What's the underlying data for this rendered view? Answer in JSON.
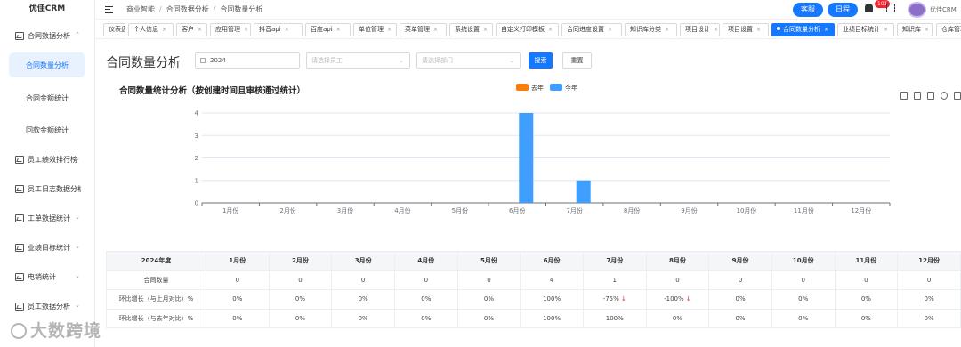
{
  "app": {
    "logo": "优佳CRM"
  },
  "sidebar": {
    "items": [
      {
        "label": "合同数据分析",
        "expanded": true
      },
      {
        "label": "合同数量分析",
        "sub": true,
        "active": true
      },
      {
        "label": "合同金额统计",
        "sub": true
      },
      {
        "label": "回款金额统计",
        "sub": true
      },
      {
        "label": "员工绩效排行榜"
      },
      {
        "label": "员工日志数据分析"
      },
      {
        "label": "工单数据统计"
      },
      {
        "label": "业绩目标统计"
      },
      {
        "label": "电销统计"
      },
      {
        "label": "员工数据分析"
      }
    ]
  },
  "header": {
    "breadcrumb": [
      "商业智能",
      "合同数据分析",
      "合同数量分析"
    ],
    "service_btn": "客服",
    "schedule_btn": "日程",
    "notify_count": "101",
    "user_name": "优佳CRM"
  },
  "tags": [
    {
      "label": "仪表盘"
    },
    {
      "label": "个人信息"
    },
    {
      "label": "客户"
    },
    {
      "label": "应用管理"
    },
    {
      "label": "抖音api"
    },
    {
      "label": "百度api"
    },
    {
      "label": "单位管理"
    },
    {
      "label": "菜单管理"
    },
    {
      "label": "系统设置"
    },
    {
      "label": "自定义打印模板"
    },
    {
      "label": "合同进度设置"
    },
    {
      "label": "知识库分类"
    },
    {
      "label": "项目设计"
    },
    {
      "label": "项目设置"
    },
    {
      "label": "合同数量分析",
      "active": true
    },
    {
      "label": "业绩目标统计"
    },
    {
      "label": "知识库"
    },
    {
      "label": "仓库管理"
    }
  ],
  "main": {
    "title": "合同数量分析",
    "filters": {
      "year": "2024",
      "employee_placeholder": "请选择员工",
      "dept_placeholder": "请选择部门",
      "search": "搜索",
      "reset": "重置"
    }
  },
  "chart_data": {
    "type": "bar",
    "title": "合同数量统计分析（按创建时间且审核通过统计）",
    "categories": [
      "1月份",
      "2月份",
      "3月份",
      "4月份",
      "5月份",
      "6月份",
      "7月份",
      "8月份",
      "9月份",
      "10月份",
      "11月份",
      "12月份"
    ],
    "series": [
      {
        "name": "去年",
        "color": "#fa7d09",
        "values": [
          0,
          0,
          0,
          0,
          0,
          0,
          0,
          0,
          0,
          0,
          0,
          0
        ]
      },
      {
        "name": "今年",
        "color": "#409eff",
        "values": [
          0,
          0,
          0,
          0,
          0,
          4,
          1,
          0,
          0,
          0,
          0,
          0
        ]
      }
    ],
    "yticks": [
      0,
      1,
      2,
      3,
      4
    ],
    "ylim": [
      0,
      4
    ],
    "legend_position": "top-center",
    "grid": true
  },
  "table": {
    "headers": [
      "2024年度",
      "1月份",
      "2月份",
      "3月份",
      "4月份",
      "5月份",
      "6月份",
      "7月份",
      "8月份",
      "9月份",
      "10月份",
      "11月份",
      "12月份"
    ],
    "rows": [
      {
        "label": "合同数量",
        "cells": [
          "0",
          "0",
          "0",
          "0",
          "0",
          "4",
          "1",
          "0",
          "0",
          "0",
          "0",
          "0"
        ]
      },
      {
        "label": "环比增长（与上月对比）%",
        "cells": [
          "0%",
          "0%",
          "0%",
          "0%",
          "0%",
          "100%",
          "-75%",
          "-100%",
          "0%",
          "0%",
          "0%",
          "0%"
        ],
        "down": [
          6,
          7
        ]
      },
      {
        "label": "环比增长（与去年对比）%",
        "cells": [
          "0%",
          "0%",
          "0%",
          "0%",
          "0%",
          "100%",
          "100%",
          "0%",
          "0%",
          "0%",
          "0%",
          "0%"
        ]
      }
    ]
  },
  "watermark": "大数跨境"
}
